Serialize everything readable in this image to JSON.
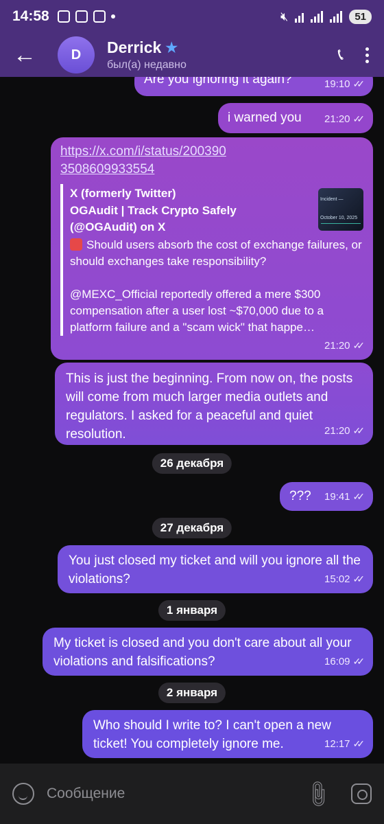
{
  "statusbar": {
    "time": "14:58",
    "battery": "51"
  },
  "header": {
    "avatar_initial": "D",
    "name": "Derrick",
    "status": "был(а) недавно"
  },
  "messages": [
    {
      "text": "Are you ignoring it again?",
      "time": "19:10"
    },
    {
      "text": "i warned you",
      "time": "21:20"
    },
    {
      "link": "https://x.com/i/status/2003903508609933554",
      "preview": {
        "site": "X (formerly Twitter)",
        "title": "OGAudit | Track Crypto Safely (@OGAudit) on X",
        "lead": "Should users absorb the cost of exchange failures, or should exchanges take responsibility?",
        "body": "@MEXC_Official reportedly offered a mere $300 compensation after a user lost ~$70,000 due to a platform failure and a \"scam wick\" that happe…",
        "thumb_label": "Incident — October 10, 2025"
      },
      "time": "21:20"
    },
    {
      "text": "This is just the beginning. From now on, the posts will come from much larger media outlets and regulators. I asked for a peaceful and quiet resolution.",
      "time": "21:20"
    },
    {
      "text": "???",
      "time": "19:41"
    },
    {
      "text": "You just closed my ticket and will you ignore all the violations?",
      "time": "15:02"
    },
    {
      "text": "My ticket is closed and you don't care about all your violations and falsifications?",
      "time": "16:09"
    },
    {
      "text": "Who should I write to? I can't open a new ticket! You completely ignore me.",
      "time": "12:17"
    }
  ],
  "dates": [
    "26 декабря",
    "27 декабря",
    "1 января",
    "2 января"
  ],
  "input": {
    "placeholder": "Сообщение"
  },
  "colors": {
    "header": "#4b2f7c",
    "bubble_top": "#9a48c9",
    "bubble_bottom": "#6a4fe0"
  }
}
